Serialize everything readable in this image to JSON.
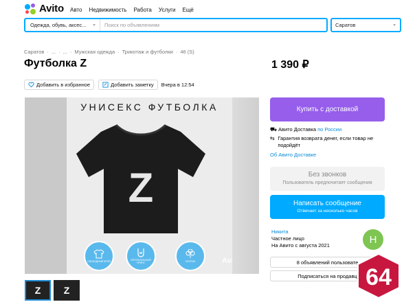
{
  "header": {
    "logo": "Avito",
    "nav": [
      "Авто",
      "Недвижимость",
      "Работа",
      "Услуги",
      "Ещё"
    ]
  },
  "search": {
    "category": "Одежда, обувь, аксес...",
    "placeholder": "Поиск по объявлениям",
    "city": "Саратов"
  },
  "breadcrumbs": [
    "Саратов",
    "·",
    "...",
    "·",
    "...",
    "·",
    "Мужская одежда",
    "·",
    "Трикотаж и футболки",
    "·",
    "46 (S)"
  ],
  "listing": {
    "title": "Футболка Z",
    "price": "1 390 ₽",
    "add_favorite": "Добавить в избранное",
    "add_note": "Добавить заметку",
    "date": "Вчера в 12:54"
  },
  "photo": {
    "heading": "УНИСЕКС ФУТБОЛКА",
    "letter": "Z",
    "badges": [
      "СВОБОДНЫЙ КРОЙ",
      "ОРИГИНАЛЬНЫЙ ПРИНТ",
      "ХЛОПОК"
    ],
    "watermark": "Avito"
  },
  "thumbnails": [
    "Z",
    "Z"
  ],
  "sidebar": {
    "buy_button": "Купить с доставкой",
    "delivery_prefix": "Авито Доставка",
    "delivery_link": "по России",
    "guarantee": "Гарантия возврата денег, если товар не подойдёт",
    "about_delivery": "Об Авито Доставке",
    "no_calls_title": "Без звонков",
    "no_calls_sub": "Пользователь предпочитает сообщения",
    "write_title": "Написать сообщение",
    "write_sub": "Отвечает за несколько часов",
    "seller_name": "Никита",
    "seller_type": "Частное лицо",
    "seller_since": "На Авито с августа 2021",
    "avatar_letter": "Н",
    "ads_button": "8 объявлений пользовате",
    "subscribe_button": "Подписаться на продавц"
  },
  "overlay_badge": "64",
  "colors": {
    "accent_blue": "#00aaff",
    "buy_purple": "#965eeb",
    "badge_red": "#c8173f"
  }
}
